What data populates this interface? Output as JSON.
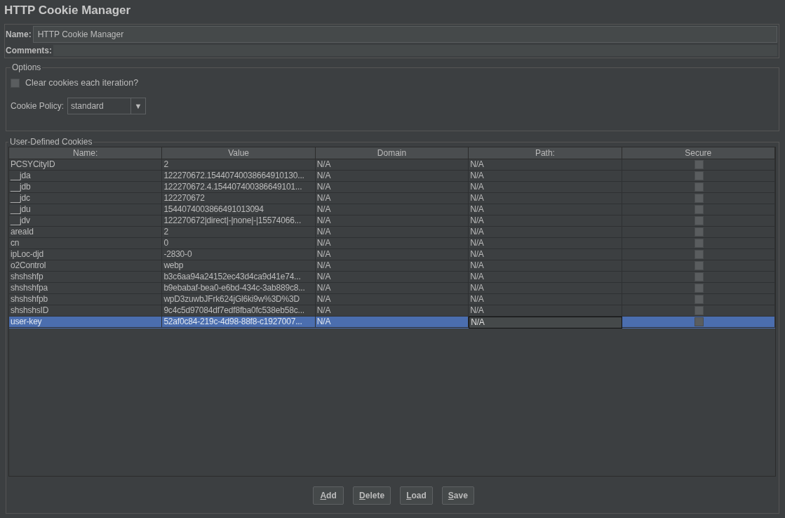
{
  "title": "HTTP Cookie Manager",
  "name_field": {
    "label": "Name:",
    "value": "HTTP Cookie Manager"
  },
  "comments_field": {
    "label": "Comments:"
  },
  "options": {
    "legend": "Options",
    "clear_cookies": {
      "label": "Clear cookies each iteration?",
      "checked": false
    },
    "policy": {
      "label": "Cookie Policy:",
      "value": "standard",
      "arrow": "▼"
    }
  },
  "cookies": {
    "legend": "User-Defined Cookies",
    "columns": [
      "Name:",
      "Value",
      "Domain",
      "Path:",
      "Secure"
    ],
    "rows": [
      {
        "name": "PCSYCityID",
        "value": "2",
        "domain": "N/A",
        "path": "N/A",
        "secure": false,
        "selected": false,
        "editing": false
      },
      {
        "name": "__jda",
        "value": "122270672.15440740038664910130...",
        "domain": "N/A",
        "path": "N/A",
        "secure": false,
        "selected": false,
        "editing": false
      },
      {
        "name": "__jdb",
        "value": "122270672.4.154407400386649101...",
        "domain": "N/A",
        "path": "N/A",
        "secure": false,
        "selected": false,
        "editing": false
      },
      {
        "name": "__jdc",
        "value": "122270672",
        "domain": "N/A",
        "path": "N/A",
        "secure": false,
        "selected": false,
        "editing": false
      },
      {
        "name": "__jdu",
        "value": "1544074003866491013094",
        "domain": "N/A",
        "path": "N/A",
        "secure": false,
        "selected": false,
        "editing": false
      },
      {
        "name": "__jdv",
        "value": "122270672|direct|-|none|-|15574066...",
        "domain": "N/A",
        "path": "N/A",
        "secure": false,
        "selected": false,
        "editing": false
      },
      {
        "name": "areaId",
        "value": "2",
        "domain": "N/A",
        "path": "N/A",
        "secure": false,
        "selected": false,
        "editing": false
      },
      {
        "name": "cn",
        "value": "0",
        "domain": "N/A",
        "path": "N/A",
        "secure": false,
        "selected": false,
        "editing": false
      },
      {
        "name": "ipLoc-djd",
        "value": "-2830-0",
        "domain": "N/A",
        "path": "N/A",
        "secure": false,
        "selected": false,
        "editing": false
      },
      {
        "name": "o2Control",
        "value": "webp",
        "domain": "N/A",
        "path": "N/A",
        "secure": false,
        "selected": false,
        "editing": false
      },
      {
        "name": "shshshfp",
        "value": "b3c6aa94a24152ec43d4ca9d41e74...",
        "domain": "N/A",
        "path": "N/A",
        "secure": false,
        "selected": false,
        "editing": false
      },
      {
        "name": "shshshfpa",
        "value": "b9ebabaf-bea0-e6bd-434c-3ab889c8...",
        "domain": "N/A",
        "path": "N/A",
        "secure": false,
        "selected": false,
        "editing": false
      },
      {
        "name": "shshshfpb",
        "value": "wpD3zuwbJFrk624jGl6ki9w%3D%3D",
        "domain": "N/A",
        "path": "N/A",
        "secure": false,
        "selected": false,
        "editing": false
      },
      {
        "name": "shshshsID",
        "value": "9c4c5d97084df7edf8fba0fc538eb58c...",
        "domain": "N/A",
        "path": "N/A",
        "secure": false,
        "selected": false,
        "editing": false
      },
      {
        "name": "user-key",
        "value": "52af0c84-219c-4d98-88f8-c1927007...",
        "domain": "N/A",
        "path": "N/A",
        "secure": false,
        "selected": true,
        "editing": true
      }
    ]
  },
  "buttons": [
    "Add",
    "Delete",
    "Load",
    "Save"
  ]
}
